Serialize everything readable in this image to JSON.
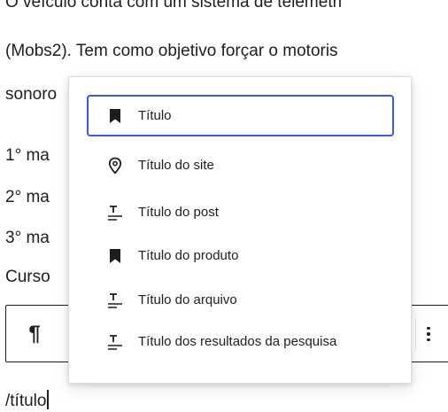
{
  "editor": {
    "lines": [
      "O veículo conta com um sistema de telemetri",
      "(Mobs2). Tem como objetivo forçar o motoris",
      "sonoro",
      "1° ma",
      "2° ma",
      "3° ma",
      "Curso"
    ],
    "slash_input": "/título"
  },
  "toolbar": {
    "paragraph_icon": "¶",
    "more_icon": "vertical-ellipsis-icon"
  },
  "menu": {
    "items": [
      {
        "label": "Título",
        "icon": "bookmark-icon",
        "selected": true
      },
      {
        "label": "Título do site",
        "icon": "map-marker-icon",
        "selected": false
      },
      {
        "label": "Título do post",
        "icon": "post-title-icon",
        "selected": false
      },
      {
        "label": "Título do produto",
        "icon": "bookmark-icon",
        "selected": false
      },
      {
        "label": "Título do arquivo",
        "icon": "post-title-icon",
        "selected": false
      },
      {
        "label": "Título dos resultados da pesquisa",
        "icon": "post-title-icon",
        "selected": false
      }
    ]
  },
  "colors": {
    "accent": "#3858e9",
    "text": "#1e1e1e"
  }
}
